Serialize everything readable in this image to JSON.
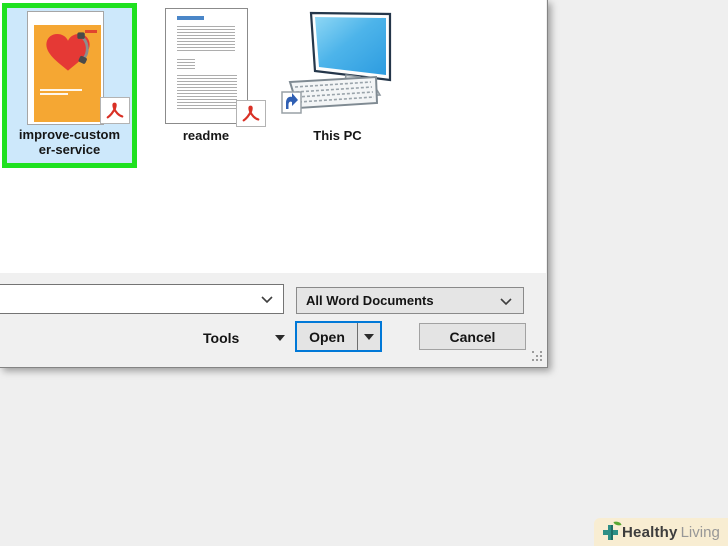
{
  "dialog": {
    "kind": "open-file-dialog",
    "files": {
      "items": [
        {
          "name": "improve-customer-service",
          "label_line1": "improve-custom",
          "label_line2": "er-service",
          "file_type": "pdf",
          "selected": true
        },
        {
          "name": "readme",
          "file_type": "pdf",
          "selected": false
        },
        {
          "name": "This PC",
          "file_type": "computer",
          "selected": false
        }
      ],
      "selection_color": "#cde8fb",
      "annotation_box_color": "#1fe11f"
    },
    "footer": {
      "filename_value": "",
      "file_type_selected": "All Word Documents",
      "tools_label": "Tools",
      "open_label": "Open",
      "cancel_label": "Cancel"
    }
  },
  "watermark": {
    "brand_bold": "Healthy",
    "brand_light": "Living",
    "background_color": "#f8edd2"
  },
  "colors": {
    "focus_blue": "#0078d7",
    "button_bg": "#e4e4e4",
    "poster_orange": "#f5a733",
    "heart_red": "#e53935",
    "pdf_red": "#d93025",
    "monitor_blue": "#35aae4",
    "shortcut_arrow_blue": "#2f5fb3",
    "logo_teal": "#2d8f86",
    "logo_leaf_green": "#58a832",
    "page_background": "#efefef"
  }
}
